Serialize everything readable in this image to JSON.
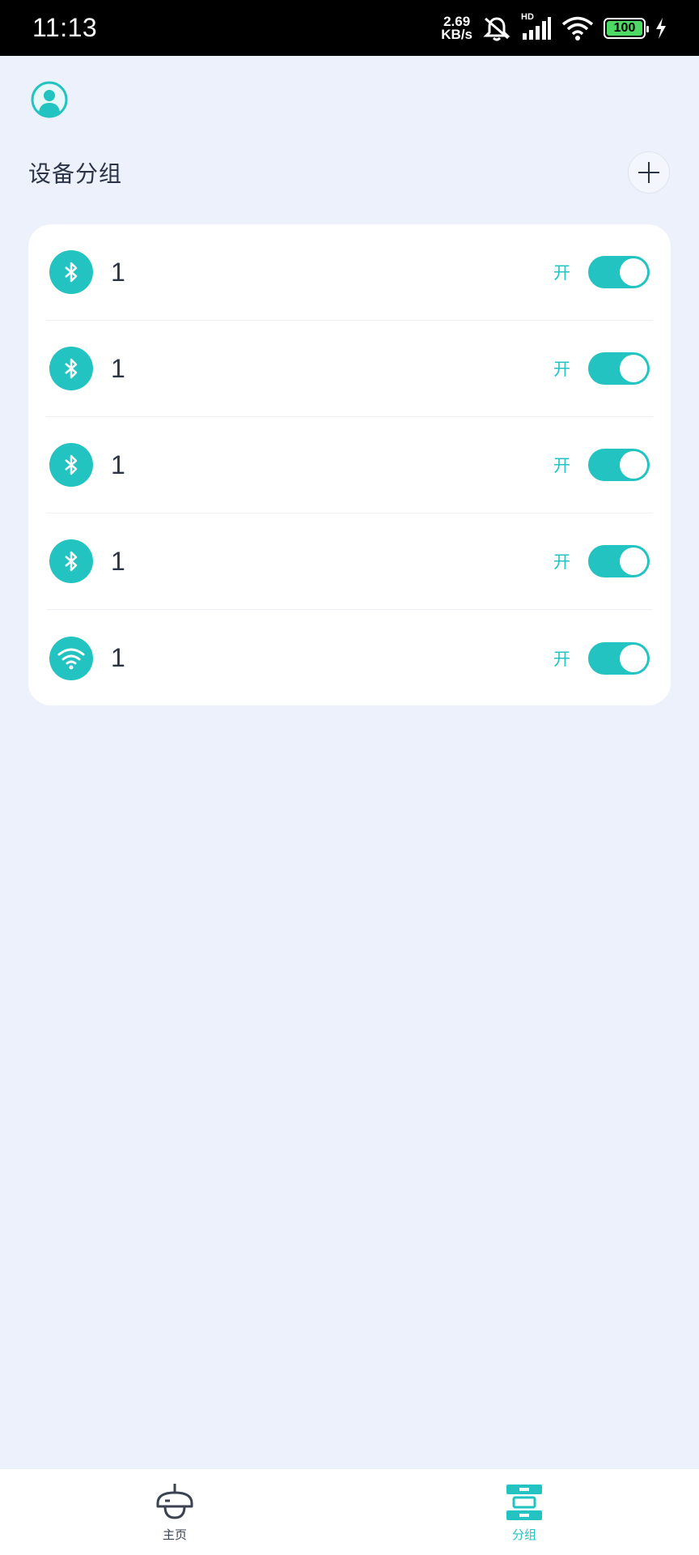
{
  "status_bar": {
    "time": "11:13",
    "net_speed_value": "2.69",
    "net_speed_unit": "KB/s",
    "signal_label": "HD",
    "battery": "100"
  },
  "header": {
    "title": "设备分组",
    "avatar_icon": "user-avatar-icon",
    "add_icon": "plus-icon"
  },
  "devices": [
    {
      "name": "1",
      "state": "开",
      "icon": "bluetooth-icon",
      "on": true
    },
    {
      "name": "1",
      "state": "开",
      "icon": "bluetooth-icon",
      "on": true
    },
    {
      "name": "1",
      "state": "开",
      "icon": "bluetooth-icon",
      "on": true
    },
    {
      "name": "1",
      "state": "开",
      "icon": "bluetooth-icon",
      "on": true
    },
    {
      "name": "1",
      "state": "开",
      "icon": "wifi-icon",
      "on": true
    }
  ],
  "nav": {
    "home_label": "主页",
    "group_label": "分组"
  },
  "colors": {
    "accent": "#22c3c0",
    "background": "#ecf1fb",
    "text": "#2b3346"
  }
}
